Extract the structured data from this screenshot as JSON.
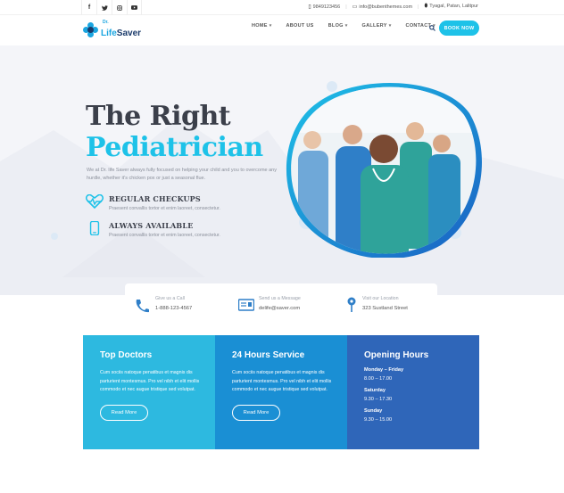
{
  "topbar": {
    "social": [
      "f",
      "t",
      "ig",
      "yt"
    ],
    "phone": "9849123456",
    "email": "info@bubenthemes.com",
    "location": "Tyagal, Patan, Lalitpur"
  },
  "header": {
    "logo_prefix": "Dr.",
    "logo_name_a": "Life",
    "logo_name_b": "Saver",
    "nav": [
      {
        "label": "HOME",
        "caret": true
      },
      {
        "label": "ABOUT US",
        "caret": false
      },
      {
        "label": "BLOG",
        "caret": true
      },
      {
        "label": "GALLERY",
        "caret": true
      },
      {
        "label": "CONTACT",
        "caret": true
      }
    ],
    "book_label": "BOOK NOW"
  },
  "hero": {
    "title_line1": "The Right",
    "title_line2": "Pediatrician",
    "description": "We at Dr. life Saver always fully focused on helping your child and you to overcome any hurdle, whether it's chicken pox or just a seasonal flue.",
    "features": [
      {
        "title": "REGULAR CHECKUPS",
        "text": "Praesent convallis tortor et enim laoreet, consectetur."
      },
      {
        "title": "ALWAYS AVAILABLE",
        "text": "Praesent convallis tortor et enim laoreet, consectetur."
      }
    ]
  },
  "contact_strip": [
    {
      "label": "Give us a Call",
      "value": "1-888-123-4567",
      "icon": "phone-icon"
    },
    {
      "label": "Send us a Message",
      "value": "delife@saver.com",
      "icon": "message-icon"
    },
    {
      "label": "Visit our Location",
      "value": "323 Sustland Street",
      "icon": "location-pin-icon"
    }
  ],
  "cards": [
    {
      "title": "Top Doctors",
      "text": "Cum sociis natoque penatibus et magnis dis parturient montesmus. Pro vel nibh et elit mollis commodo et nec augue tristique sed volutpat.",
      "button": "Read More",
      "color": "#2db9e0"
    },
    {
      "title": "24 Hours Service",
      "text": "Cum sociis natoque penatibus et magnis dis parturient montesmus. Pro vel nibh et elit mollis commodo et nec augue tristique sed volutpat.",
      "button": "Read More",
      "color": "#1a8fd4"
    },
    {
      "title": "Opening Hours",
      "color": "#2f66b9",
      "hours": [
        {
          "label": "Monday – Friday",
          "value": "8.00 – 17.00"
        },
        {
          "label": "Saturday",
          "value": "9.30 – 17.30"
        },
        {
          "label": "Sunday",
          "value": "9.30 – 15.00"
        }
      ]
    }
  ],
  "colors": {
    "accent": "#1ec2e8",
    "dark": "#3b3f4a"
  }
}
